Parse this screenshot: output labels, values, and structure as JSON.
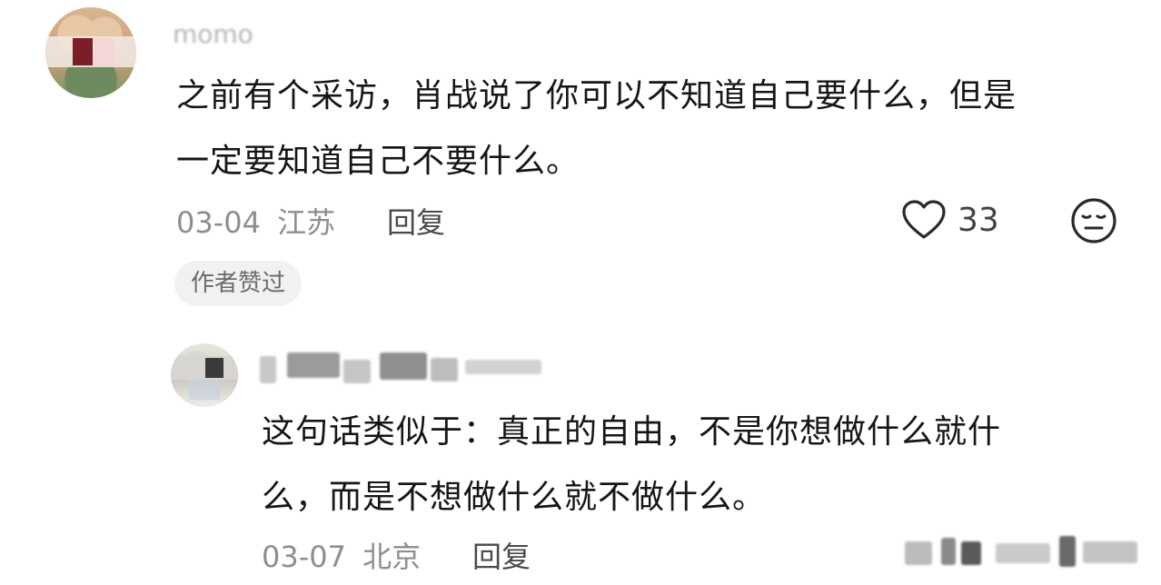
{
  "comment": {
    "username": "momo",
    "text_line1": "之前有个采访，肖战说了你可以不知道自己要什么，但是",
    "text_line2": "一定要知道自己不要什么。",
    "date": "03-04",
    "location": "江苏",
    "reply_label": "回复",
    "like_count": "33",
    "author_badge": "作者赞过",
    "icons": [
      "heart-icon",
      "dislike-face-icon"
    ]
  },
  "reply": {
    "text_line1": "这句话类似于：真正的自由，不是你想做什么就什",
    "text_line2": "么，而是不想做什么就不做什么。",
    "date": "03-07",
    "location": "北京",
    "reply_label": "回复"
  },
  "colors": {
    "text": "#161616",
    "meta": "#8e8e8e",
    "badge_bg": "#f1f1f1"
  }
}
